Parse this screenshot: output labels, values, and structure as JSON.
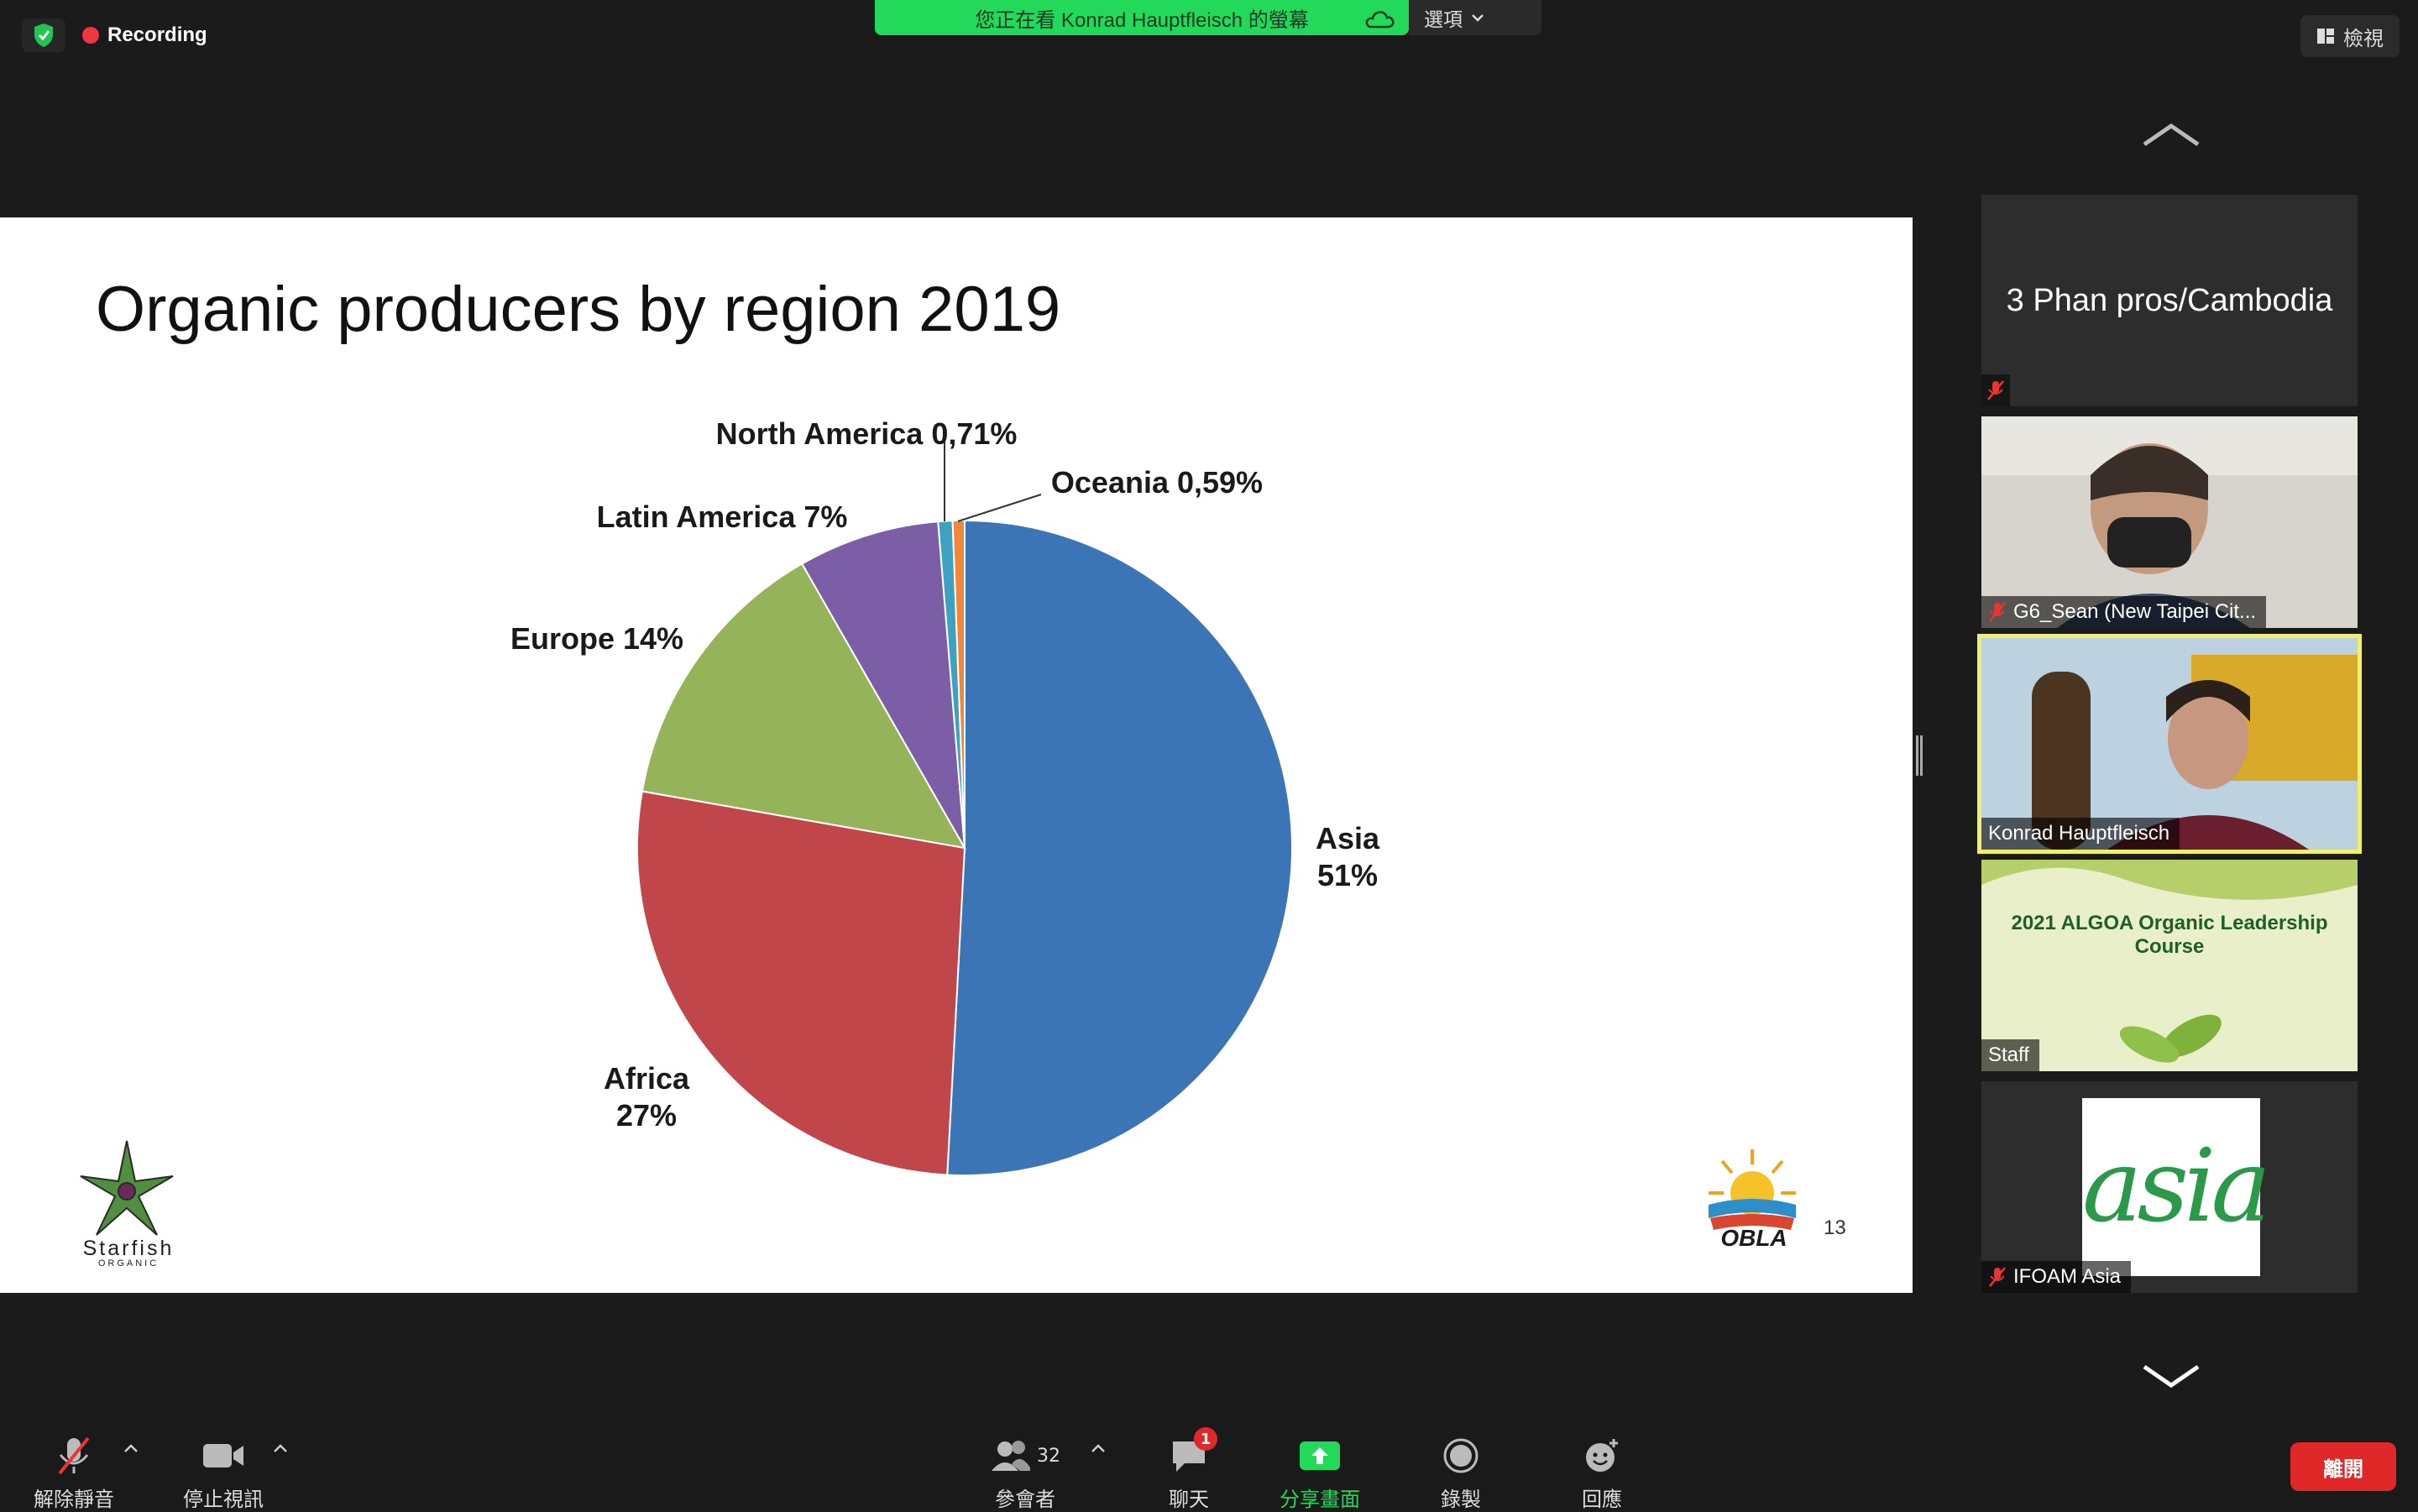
{
  "topbar": {
    "recording_label": "Recording",
    "share_banner": "您正在看 Konrad Hauptfleisch 的螢幕",
    "options_label": "選項",
    "view_label": "檢視"
  },
  "slide": {
    "title": "Organic producers by region 2019",
    "page_number": "13",
    "left_logo_text": "Starfish",
    "left_logo_sub": "ORGANIC",
    "right_logo_text": "OBLA"
  },
  "chart_data": {
    "type": "pie",
    "title": "Organic producers by region 2019",
    "categories": [
      "Asia",
      "Africa",
      "Europe",
      "Latin America",
      "North America",
      "Oceania"
    ],
    "values": [
      51,
      27,
      14,
      7,
      0.71,
      0.59
    ],
    "labels": {
      "asia": "Asia",
      "asia_pct": "51%",
      "africa": "Africa",
      "africa_pct": "27%",
      "europe": "Europe 14%",
      "latin_america": "Latin America 7%",
      "north_america": "North America 0,71%",
      "oceania": "Oceania 0,59%"
    },
    "colors": [
      "#3b75b5",
      "#c0464a",
      "#95b459",
      "#7b5ea5",
      "#3fa1c1",
      "#f0883b"
    ]
  },
  "gallery": {
    "tiles": [
      {
        "name": "3 Phan pros/Cambodia",
        "muted": true
      },
      {
        "name": "G6_Sean (New Taipei Cit...",
        "muted": true
      },
      {
        "name": "Konrad Hauptfleisch",
        "muted": false,
        "active": true
      },
      {
        "name": "Staff",
        "muted": false,
        "banner": "2021 ALGOA Organic Leadership Course"
      },
      {
        "name": "IFOAM Asia",
        "muted": true,
        "logo_text": "asia"
      }
    ]
  },
  "toolbar": {
    "unmute": "解除靜音",
    "stop_video": "停止視訊",
    "participants": "參會者",
    "participants_count": "32",
    "chat": "聊天",
    "chat_badge": "1",
    "share_screen": "分享畫面",
    "record": "錄製",
    "reactions": "回應",
    "leave": "離開"
  },
  "colors": {
    "share_green": "#23d959",
    "leave_red": "#e02828",
    "active_speaker": "#f1f06a"
  }
}
